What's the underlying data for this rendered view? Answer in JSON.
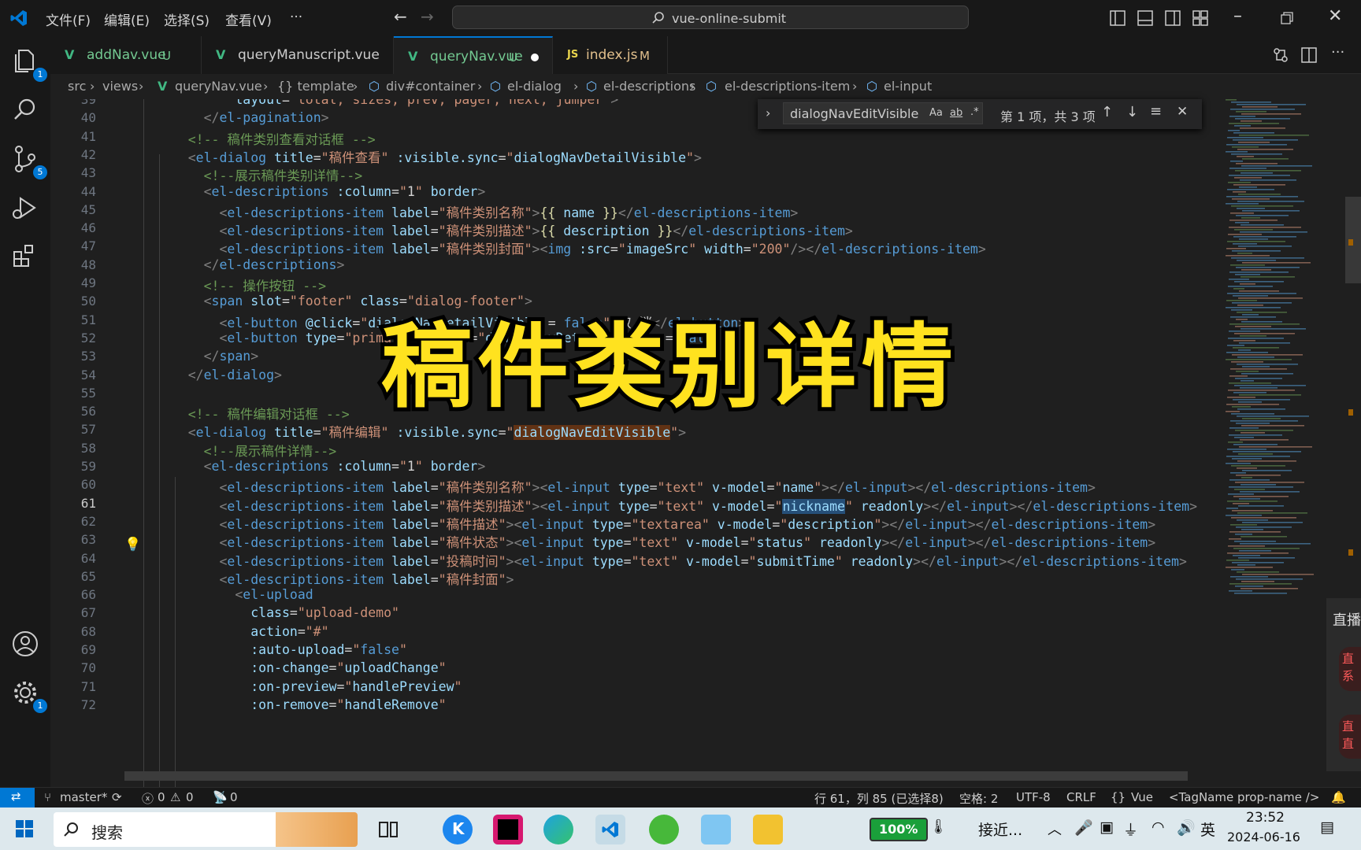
{
  "menu": {
    "file": "文件(F)",
    "edit": "编辑(E)",
    "selection": "选择(S)",
    "view": "查看(V)",
    "more": "···"
  },
  "command_center": {
    "text": "vue-online-submit"
  },
  "activity": {
    "explorer_badge": "1",
    "scm_badge": "5",
    "settings_badge": "1"
  },
  "tabs": [
    {
      "label": "addNav.vue",
      "status": "U"
    },
    {
      "label": "queryManuscript.vue",
      "status": ""
    },
    {
      "label": "queryNav.vue",
      "status": "U"
    },
    {
      "label": "index.js",
      "status": "M",
      "prefix": "JS"
    }
  ],
  "breadcrumb": [
    "src",
    "views",
    "queryNav.vue",
    "{} template",
    "div#container",
    "el-dialog",
    "el-descriptions",
    "el-descriptions-item",
    "el-input"
  ],
  "find": {
    "query": "dialogNavEditVisible",
    "match_case": "Aa",
    "whole_word": "ab",
    "regex": ".*",
    "result": "第 1 项，共 3 项"
  },
  "overlay_title": "稿件类别详情",
  "lines": [
    {
      "n": "39",
      "html": "<span class='a'>          layout</span>=<span class='s'>\"total, sizes, prev, pager, next, jumper\"</span><span class='p'>&gt;</span>"
    },
    {
      "n": "40",
      "html": "<span class='p'>      &lt;/</span><span class='t'>el-pagination</span><span class='p'>&gt;</span>"
    },
    {
      "n": "41",
      "html": "<span class='c'>    &lt;!-- 稿件类别查看对话框 --&gt;</span>"
    },
    {
      "n": "42",
      "html": "<span class='p'>    &lt;</span><span class='t'>el-dialog</span> <span class='a'>title</span>=<span class='s'>\"稿件查看\"</span> <span class='a'>:visible.sync</span>=<span class='s'>\"</span><span class='a'>dialogNavDetailVisible</span><span class='s'>\"</span><span class='p'>&gt;</span>"
    },
    {
      "n": "43",
      "html": "<span class='c'>      &lt;!--展示稿件类别详情--&gt;</span>"
    },
    {
      "n": "44",
      "html": "<span class='p'>      &lt;</span><span class='t'>el-descriptions</span> <span class='a'>:column</span>=<span class='s'>\"</span>1<span class='s'>\"</span> <span class='a'>border</span><span class='p'>&gt;</span>"
    },
    {
      "n": "45",
      "html": "<span class='p'>        &lt;</span><span class='t'>el-descriptions-item</span> <span class='a'>label</span>=<span class='s'>\"稿件类别名称\"</span><span class='p'>&gt;</span><span class='y'>{{</span> <span class='a'>name</span> <span class='y'>}}</span><span class='p'>&lt;/</span><span class='t'>el-descriptions-item</span><span class='p'>&gt;</span>"
    },
    {
      "n": "46",
      "html": "<span class='p'>        &lt;</span><span class='t'>el-descriptions-item</span> <span class='a'>label</span>=<span class='s'>\"稿件类别描述\"</span><span class='p'>&gt;</span><span class='y'>{{</span> <span class='a'>description</span> <span class='y'>}}</span><span class='p'>&lt;/</span><span class='t'>el-descriptions-item</span><span class='p'>&gt;</span>"
    },
    {
      "n": "47",
      "html": "<span class='p'>        &lt;</span><span class='t'>el-descriptions-item</span> <span class='a'>label</span>=<span class='s'>\"稿件类别封面\"</span><span class='p'>&gt;&lt;</span><span class='t'>img</span> <span class='a'>:src</span>=<span class='s'>\"</span><span class='a'>imageSrc</span><span class='s'>\"</span> <span class='a'>width</span>=<span class='s'>\"200\"</span><span class='p'>/&gt;&lt;/</span><span class='t'>el-descriptions-item</span><span class='p'>&gt;</span>"
    },
    {
      "n": "48",
      "html": "<span class='p'>      &lt;/</span><span class='t'>el-descriptions</span><span class='p'>&gt;</span>"
    },
    {
      "n": "49",
      "html": "<span class='c'>      &lt;!-- 操作按钮 --&gt;</span>"
    },
    {
      "n": "50",
      "html": "<span class='p'>      &lt;</span><span class='t'>span</span> <span class='a'>slot</span>=<span class='s'>\"footer\"</span> <span class='a'>class</span>=<span class='s'>\"dialog-footer\"</span><span class='p'>&gt;</span>"
    },
    {
      "n": "51",
      "html": "<span class='p'>        &lt;</span><span class='t'>el-button</span> <span class='a'>@click</span>=<span class='s'>\"</span><span class='a'>dialogNavDetailVisible</span> = <span class='t'>false</span><span class='s'>\"</span><span class='p'>&gt;</span>取 消<span class='p'>&lt;/</span><span class='t'>el-button</span><span class='p'>&gt;</span>"
    },
    {
      "n": "52",
      "html": "<span class='p'>        &lt;</span><span class='t'>el-button</span> <span class='a'>type</span>=<span class='s'>\"primary\"</span> <span class='a'>@click</span>=<span class='s'>\"</span><span class='a'>dialogNavDetailVisible</span> = <span class='t'>false</span><span class='s'>\"</span><span class='p'>&gt;</span>"
    },
    {
      "n": "53",
      "html": "<span class='p'>      &lt;/</span><span class='t'>span</span><span class='p'>&gt;</span>"
    },
    {
      "n": "54",
      "html": "<span class='p'>    &lt;/</span><span class='t'>el-dialog</span><span class='p'>&gt;</span>"
    },
    {
      "n": "55",
      "html": ""
    },
    {
      "n": "56",
      "html": "<span class='c'>    &lt;!-- 稿件编辑对话框 --&gt;</span>"
    },
    {
      "n": "57",
      "html": "<span class='p'>    &lt;</span><span class='t'>el-dialog</span> <span class='a'>title</span>=<span class='s'>\"稿件编辑\"</span> <span class='a'>:visible.sync</span>=<span class='s'>\"</span><span class='a hl'>dialogNavEditVisible</span><span class='s'>\"</span><span class='p'>&gt;</span>"
    },
    {
      "n": "58",
      "html": "<span class='c'>      &lt;!--展示稿件详情--&gt;</span>"
    },
    {
      "n": "59",
      "html": "<span class='p'>      &lt;</span><span class='t'>el-descriptions</span> <span class='a'>:column</span>=<span class='s'>\"</span>1<span class='s'>\"</span> <span class='a'>border</span><span class='p'>&gt;</span>"
    },
    {
      "n": "60",
      "html": "<span class='p'>        &lt;</span><span class='t'>el-descriptions-item</span> <span class='a'>label</span>=<span class='s'>\"稿件类别名称\"</span><span class='p'>&gt;&lt;</span><span class='t'>el-input</span> <span class='a'>type</span>=<span class='s'>\"text\"</span> <span class='a'>v-model</span>=<span class='s'>\"</span><span class='a'>name</span><span class='s'>\"</span><span class='p'>&gt;&lt;/</span><span class='t'>el-input</span><span class='p'>&gt;&lt;/</span><span class='t'>el-descriptions-item</span><span class='p'>&gt;</span>"
    },
    {
      "n": "61",
      "html": "<span class='p'>        &lt;</span><span class='t'>el-descriptions-item</span> <span class='a'>label</span>=<span class='s'>\"稿件类别描述\"</span><span class='p'>&gt;&lt;</span><span class='t'>el-input</span> <span class='a'>type</span>=<span class='s'>\"text\"</span> <span class='a'>v-model</span>=<span class='s'>\"</span><span class='a sel'>nickname</span><span class='s'>\"</span> <span class='a'>readonly</span><span class='p'>&gt;&lt;/</span><span class='t'>el-input</span><span class='p'>&gt;&lt;/</span><span class='t'>el-descriptions-item</span><span class='p'>&gt;</span>"
    },
    {
      "n": "62",
      "html": "<span class='p'>        &lt;</span><span class='t'>el-descriptions-item</span> <span class='a'>label</span>=<span class='s'>\"稿件描述\"</span><span class='p'>&gt;&lt;</span><span class='t'>el-input</span> <span class='a'>type</span>=<span class='s'>\"textarea\"</span> <span class='a'>v-model</span>=<span class='s'>\"</span><span class='a'>description</span><span class='s'>\"</span><span class='p'>&gt;&lt;/</span><span class='t'>el-input</span><span class='p'>&gt;&lt;/</span><span class='t'>el-descriptions-item</span><span class='p'>&gt;</span>"
    },
    {
      "n": "63",
      "html": "<span class='p'>        &lt;</span><span class='t'>el-descriptions-item</span> <span class='a'>label</span>=<span class='s'>\"稿件状态\"</span><span class='p'>&gt;&lt;</span><span class='t'>el-input</span> <span class='a'>type</span>=<span class='s'>\"text\"</span> <span class='a'>v-model</span>=<span class='s'>\"</span><span class='a'>status</span><span class='s'>\"</span> <span class='a'>readonly</span><span class='p'>&gt;&lt;/</span><span class='t'>el-input</span><span class='p'>&gt;&lt;/</span><span class='t'>el-descriptions-item</span><span class='p'>&gt;</span>"
    },
    {
      "n": "64",
      "html": "<span class='p'>        &lt;</span><span class='t'>el-descriptions-item</span> <span class='a'>label</span>=<span class='s'>\"投稿时间\"</span><span class='p'>&gt;&lt;</span><span class='t'>el-input</span> <span class='a'>type</span>=<span class='s'>\"text\"</span> <span class='a'>v-model</span>=<span class='s'>\"</span><span class='a'>submitTime</span><span class='s'>\"</span> <span class='a'>readonly</span><span class='p'>&gt;&lt;/</span><span class='t'>el-input</span><span class='p'>&gt;&lt;/</span><span class='t'>el-descriptions-item</span><span class='p'>&gt;</span>"
    },
    {
      "n": "65",
      "html": "<span class='p'>        &lt;</span><span class='t'>el-descriptions-item</span> <span class='a'>label</span>=<span class='s'>\"稿件封面\"</span><span class='p'>&gt;</span>"
    },
    {
      "n": "66",
      "html": "<span class='p'>          &lt;</span><span class='t'>el-upload</span>"
    },
    {
      "n": "67",
      "html": "<span class='a'>            class</span>=<span class='s'>\"upload-demo\"</span>"
    },
    {
      "n": "68",
      "html": "<span class='a'>            action</span>=<span class='s'>\"#\"</span>"
    },
    {
      "n": "69",
      "html": "<span class='a'>            :auto-upload</span>=<span class='s'>\"</span><span class='t'>false</span><span class='s'>\"</span>"
    },
    {
      "n": "70",
      "html": "<span class='a'>            :on-change</span>=<span class='s'>\"</span><span class='a'>uploadChange</span><span class='s'>\"</span>"
    },
    {
      "n": "71",
      "html": "<span class='a'>            :on-preview</span>=<span class='s'>\"</span><span class='a'>handlePreview</span><span class='s'>\"</span>"
    },
    {
      "n": "72",
      "html": "<span class='a'>            :on-remove</span>=<span class='s'>\"</span><span class='a'>handleRemove</span><span class='s'>\"</span>"
    }
  ],
  "status": {
    "branch": "master*",
    "errors": "0",
    "warnings": "0",
    "ports": "0",
    "cursor": "行 61，列 85 (已选择8)",
    "indent": "空格: 2",
    "encoding": "UTF-8",
    "eol": "CRLF",
    "language": "Vue",
    "formatter": "<TagName prop-name />"
  },
  "side_panel": {
    "title": "直播",
    "item1": "直\n系",
    "item2": "直\n直"
  },
  "taskbar": {
    "search": "搜索",
    "battery": "100%",
    "weather": "接近...",
    "ime": "英",
    "time": "23:52",
    "date": "2024-06-16"
  }
}
